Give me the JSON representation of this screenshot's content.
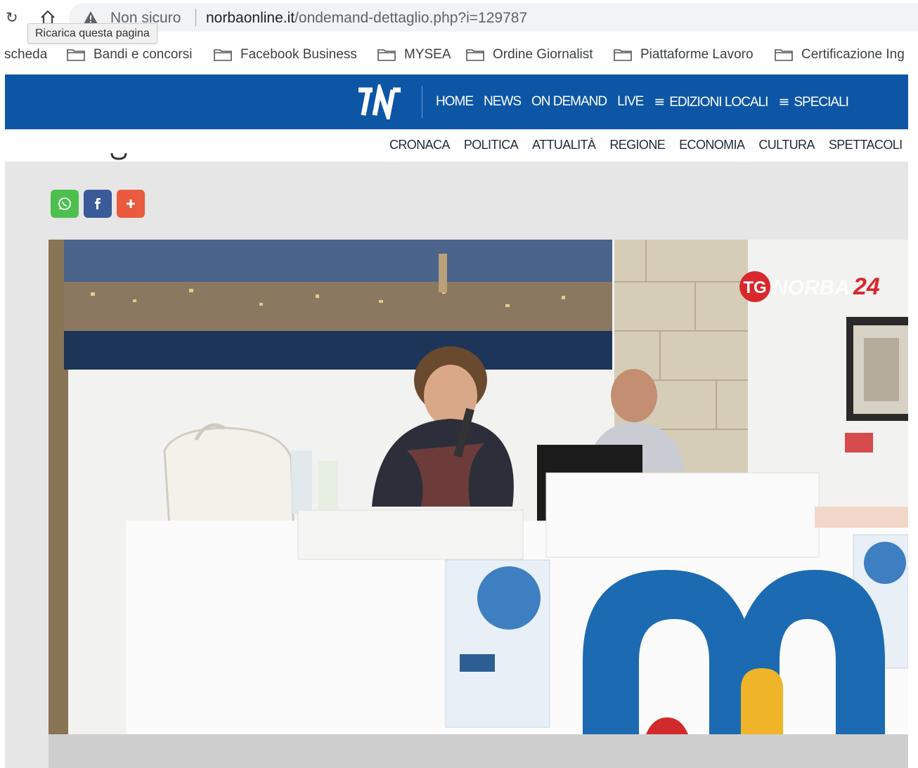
{
  "browser": {
    "not_secure": "Non sicuro",
    "url_host": "norbaonline.it",
    "url_path": "/ondemand-dettaglio.php?i=129787",
    "tooltip": "Ricarica questa pagina",
    "reload_icon": "reload-icon",
    "home_icon": "home-icon",
    "warning_icon": "warning-icon"
  },
  "bookmarks": [
    {
      "label": "scheda",
      "icon": ""
    },
    {
      "label": "Bandi e concorsi",
      "icon": "folder-icon"
    },
    {
      "label": "Facebook Business",
      "icon": "folder-icon"
    },
    {
      "label": "MYSEA",
      "icon": "folder-icon"
    },
    {
      "label": "Ordine Giornalist",
      "icon": "folder-icon"
    },
    {
      "label": "Piattaforme Lavoro",
      "icon": "folder-icon"
    },
    {
      "label": "Certificazione Ing",
      "icon": "folder-icon"
    }
  ],
  "site": {
    "brand_color": "#0d56a6",
    "nav": {
      "home": "HOME",
      "news": "NEWS",
      "on_demand": "ON DEMAND",
      "live": "LIVE",
      "edizioni_locali": "EDIZIONI LOCALI",
      "speciali": "SPECIALI"
    },
    "categories": [
      "CRONACA",
      "POLITICA",
      "ATTUALITÀ",
      "REGIONE",
      "ECONOMIA",
      "CULTURA",
      "SPETTACOLI"
    ]
  },
  "share": {
    "whatsapp_color": "#4dbf4e",
    "facebook_color": "#3a5a99",
    "more_color": "#ea5a3e"
  },
  "video": {
    "channel_logo_tg": "TG",
    "channel_logo_name": "NORBA",
    "channel_logo_number": "24"
  }
}
